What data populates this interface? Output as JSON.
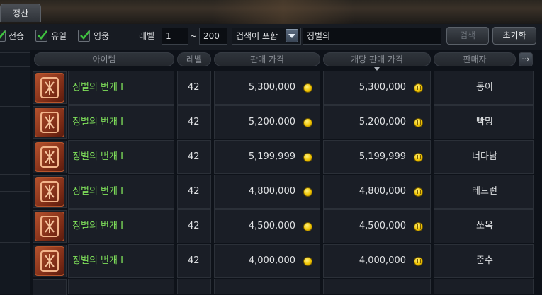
{
  "tab": {
    "label": "정산"
  },
  "filters": {
    "checks": [
      {
        "label": "전승",
        "checked": true
      },
      {
        "label": "유일",
        "checked": true
      },
      {
        "label": "영웅",
        "checked": true
      }
    ],
    "level_label": "레벨",
    "level_min": "1",
    "level_sep": "~",
    "level_max": "200",
    "search_mode": "검색어 포함",
    "search_value": "징벌의",
    "search_button": "검색",
    "reset_button": "초기화"
  },
  "columns": {
    "item": "아이템",
    "level": "레벨",
    "price": "판매 가격",
    "unit_price": "개당 판매 가격",
    "seller": "판매자",
    "more": "··›"
  },
  "rows": [
    {
      "name": "징벌의 번개 I",
      "level": "42",
      "price": "5,300,000",
      "unit_price": "5,300,000",
      "seller": "동이"
    },
    {
      "name": "징벌의 번개 I",
      "level": "42",
      "price": "5,200,000",
      "unit_price": "5,200,000",
      "seller": "빡밍"
    },
    {
      "name": "징벌의 번개 I",
      "level": "42",
      "price": "5,199,999",
      "unit_price": "5,199,999",
      "seller": "너다남"
    },
    {
      "name": "징벌의 번개 I",
      "level": "42",
      "price": "4,800,000",
      "unit_price": "4,800,000",
      "seller": "레드런"
    },
    {
      "name": "징벌의 번개 I",
      "level": "42",
      "price": "4,500,000",
      "unit_price": "4,500,000",
      "seller": "쏘옥"
    },
    {
      "name": "징벌의 번개 I",
      "level": "42",
      "price": "4,000,000",
      "unit_price": "4,000,000",
      "seller": "준수"
    }
  ],
  "colors": {
    "item_name": "#7fe05a",
    "check_mark": "#3fc43f",
    "coin": "#f0c400",
    "item_icon": "#b4512d"
  }
}
